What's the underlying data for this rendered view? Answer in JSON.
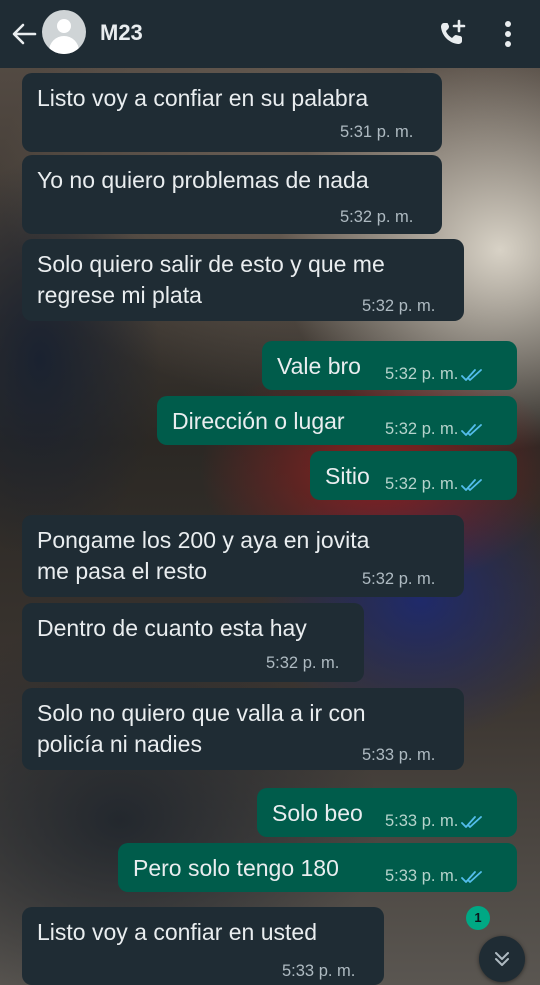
{
  "header": {
    "title": "M23",
    "icons": [
      "back-arrow-icon",
      "avatar",
      "add-call-icon",
      "more-vertical-icon"
    ]
  },
  "messages": [
    {
      "dir": "in",
      "lines": [
        "Listo voy a confiar en su palabra"
      ],
      "time": "5:31 p. m."
    },
    {
      "dir": "in",
      "lines": [
        "Yo no quiero problemas de nada"
      ],
      "time": "5:32 p. m."
    },
    {
      "dir": "in",
      "lines": [
        "Solo quiero salir de esto y que me",
        "regrese mi plata"
      ],
      "time": "5:32 p. m."
    },
    {
      "dir": "out",
      "lines": [
        "Vale bro"
      ],
      "time": "5:32 p. m."
    },
    {
      "dir": "out",
      "lines": [
        "Dirección o lugar"
      ],
      "time": "5:32 p. m."
    },
    {
      "dir": "out",
      "lines": [
        "Sitio"
      ],
      "time": "5:32 p. m."
    },
    {
      "dir": "in",
      "lines": [
        "Pongame los 200 y aya en jovita",
        "me pasa el resto"
      ],
      "time": "5:32 p. m."
    },
    {
      "dir": "in",
      "lines": [
        "Dentro de cuanto esta hay"
      ],
      "time": "5:32 p. m."
    },
    {
      "dir": "in",
      "lines": [
        "Solo no quiero que valla a ir con",
        "policía ni nadies"
      ],
      "time": "5:33 p. m."
    },
    {
      "dir": "out",
      "lines": [
        "Solo beo"
      ],
      "time": "5:33 p. m."
    },
    {
      "dir": "out",
      "lines": [
        "Pero solo tengo 180"
      ],
      "time": "5:33 p. m."
    },
    {
      "dir": "in",
      "lines": [
        "Listo voy a confiar en usted"
      ],
      "time": "5:33 p. m."
    }
  ],
  "unread_count": "1",
  "colors": {
    "header_bg": "#1f2c34",
    "incoming_bg": "#1f2c34",
    "outgoing_bg": "#005c4b",
    "read_tick": "#53bdeb",
    "badge": "#00a884"
  }
}
